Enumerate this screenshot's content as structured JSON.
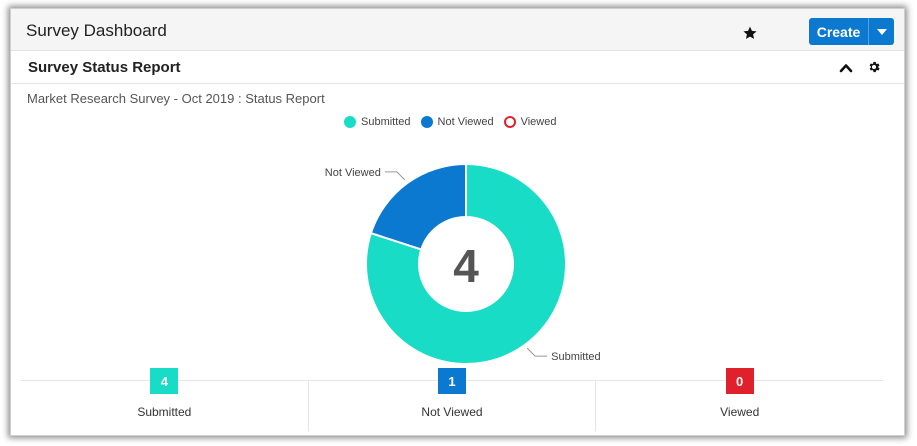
{
  "header": {
    "title": "Survey Dashboard",
    "favorite_icon": "star-icon",
    "create_label": "Create",
    "create_caret_icon": "caret-down-icon",
    "accent_color": "#0b79d0"
  },
  "panel": {
    "title": "Survey Status Report",
    "collapse_icon": "chevron-up-icon",
    "settings_icon": "gear-icon"
  },
  "report": {
    "subtitle": "Market Research Survey - Oct 2019 : Status Report",
    "center_total": "4"
  },
  "chart_data": {
    "type": "pie",
    "variant": "donut",
    "categories": [
      "Submitted",
      "Not Viewed",
      "Viewed"
    ],
    "values": [
      4,
      1,
      0
    ],
    "colors": [
      "#19dcc6",
      "#0b79d0",
      "#e0212b"
    ],
    "legend": [
      "Submitted",
      "Not Viewed",
      "Viewed"
    ],
    "legend_placement": "top",
    "center_label": "4",
    "slice_labels": [
      "Submitted",
      "Not Viewed"
    ]
  },
  "stats": [
    {
      "value": "4",
      "label": "Submitted",
      "color": "#19dcc6"
    },
    {
      "value": "1",
      "label": "Not Viewed",
      "color": "#0b79d0"
    },
    {
      "value": "0",
      "label": "Viewed",
      "color": "#e0212b"
    }
  ]
}
